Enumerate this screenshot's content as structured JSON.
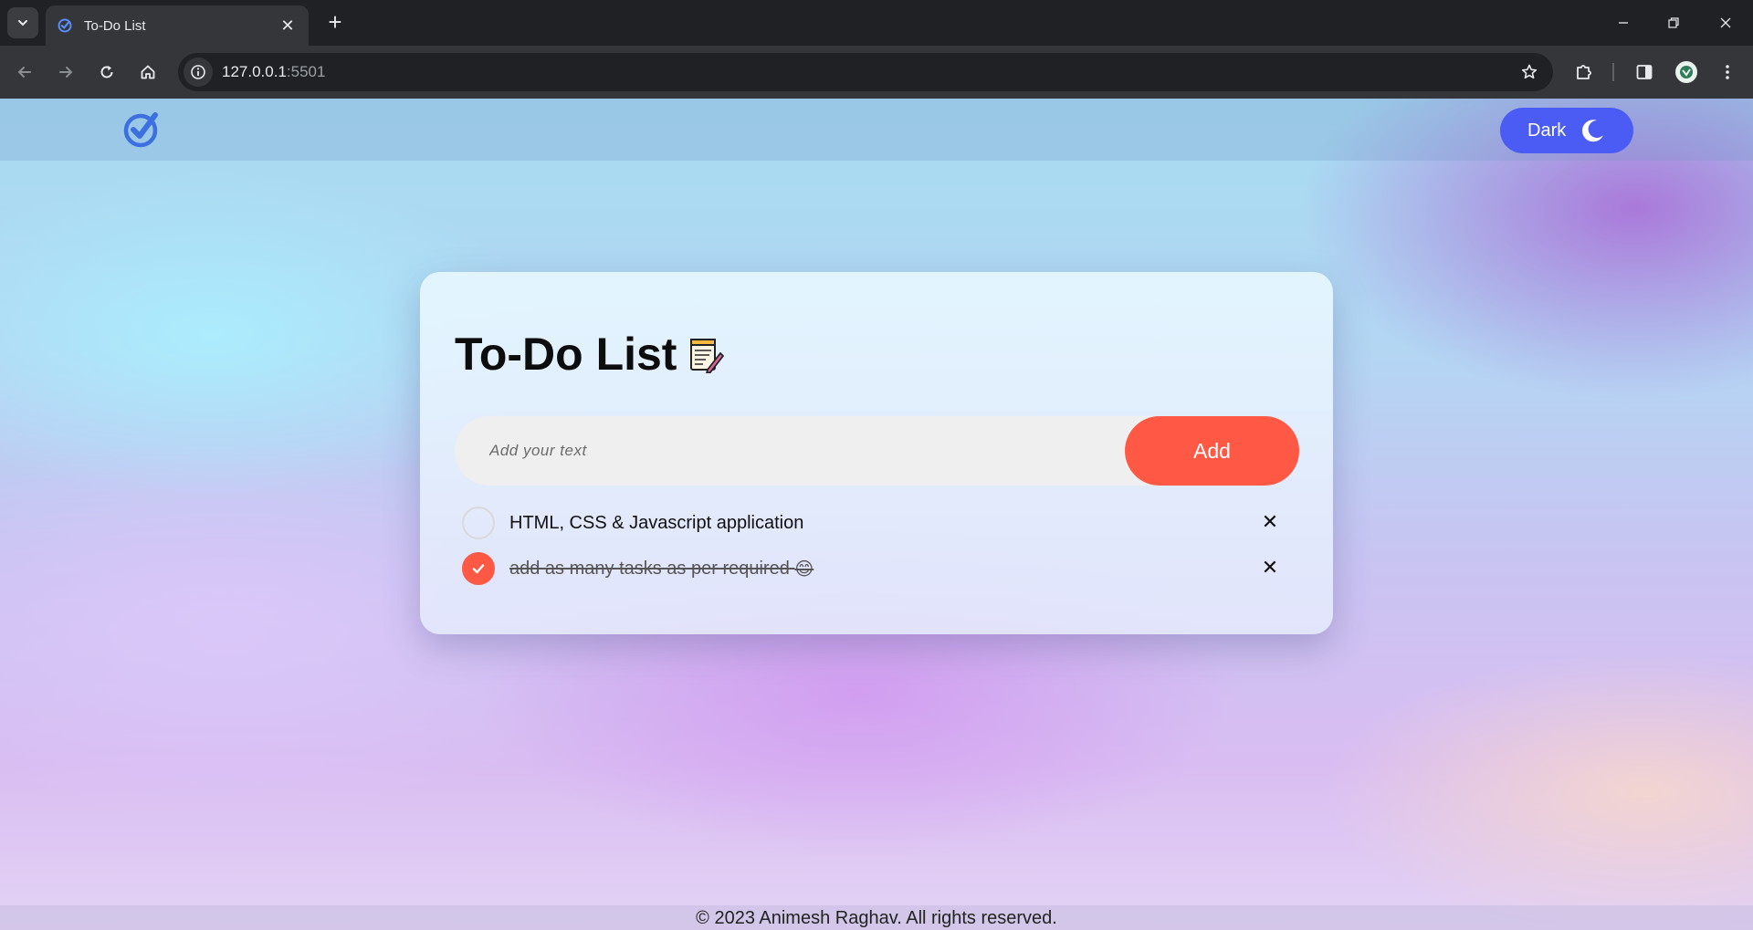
{
  "browser": {
    "tab_title": "To-Do List",
    "tab_close": "✕",
    "new_tab": "+",
    "url_host": "127.0.0.1",
    "url_port": ":5501",
    "icons": {
      "tab_search": "chevron-down-icon",
      "favicon": "check-circle-icon",
      "back": "back-arrow-icon",
      "forward": "forward-arrow-icon",
      "reload": "reload-icon",
      "home": "home-icon",
      "site_info": "info-icon",
      "bookmark": "star-icon",
      "extensions": "puzzle-icon",
      "side_panel": "side-panel-icon",
      "profile": "avatar-icon",
      "menu": "kebab-menu-icon"
    }
  },
  "navbar": {
    "logo_icon": "check-circle-icon",
    "theme_button_label": "Dark",
    "theme_icon": "moon-icon",
    "accent": "#4a5cf4"
  },
  "todo": {
    "title": "To-Do List",
    "title_icon": "notepad-pencil-icon",
    "input_placeholder": "Add your text",
    "input_value": "",
    "add_label": "Add",
    "add_color": "#ff5945",
    "tasks": [
      {
        "text": "HTML, CSS & Javascript application",
        "completed": false,
        "delete_label": "✕"
      },
      {
        "text": "add as many tasks as per required",
        "emoji": "😊",
        "completed": true,
        "delete_label": "✕"
      }
    ]
  },
  "footer": {
    "text": "© 2023 Animesh Raghav. All rights reserved."
  }
}
